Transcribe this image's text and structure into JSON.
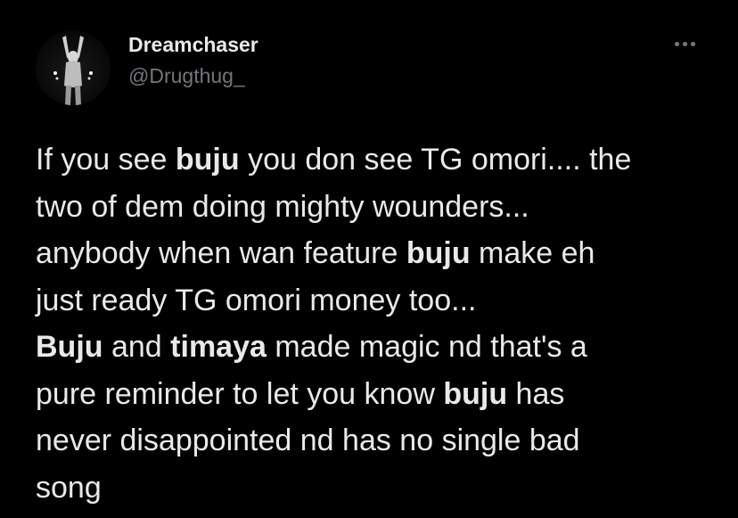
{
  "author": {
    "name": "Dreamchaser",
    "handle": "@Drugthug_",
    "avatar_icon": "profile-photo"
  },
  "menu": {
    "more_icon": "more-horizontal-icon"
  },
  "tweet": {
    "lines": [
      {
        "segments": [
          {
            "text": "If you see ",
            "bold": false
          },
          {
            "text": "buju",
            "bold": true
          },
          {
            "text": " you don see TG omori.... the",
            "bold": false
          }
        ]
      },
      {
        "segments": [
          {
            "text": "two of dem doing mighty wounders...",
            "bold": false
          }
        ]
      },
      {
        "segments": [
          {
            "text": "anybody when wan feature ",
            "bold": false
          },
          {
            "text": "buju",
            "bold": true
          },
          {
            "text": " make eh",
            "bold": false
          }
        ]
      },
      {
        "segments": [
          {
            "text": "just ready TG omori money too...",
            "bold": false
          }
        ]
      },
      {
        "segments": [
          {
            "text": "Buju",
            "bold": true
          },
          {
            "text": " and ",
            "bold": false
          },
          {
            "text": "timaya",
            "bold": true
          },
          {
            "text": " made magic nd that's a",
            "bold": false
          }
        ]
      },
      {
        "segments": [
          {
            "text": "pure reminder to let you know ",
            "bold": false
          },
          {
            "text": "buju",
            "bold": true
          },
          {
            "text": " has",
            "bold": false
          }
        ]
      },
      {
        "segments": [
          {
            "text": "never disappointed nd has no single bad",
            "bold": false
          }
        ]
      },
      {
        "segments": [
          {
            "text": "song",
            "bold": false
          }
        ]
      }
    ]
  },
  "colors": {
    "background": "#000000",
    "primary_text": "#e7e9ea",
    "secondary_text": "#71767b"
  }
}
